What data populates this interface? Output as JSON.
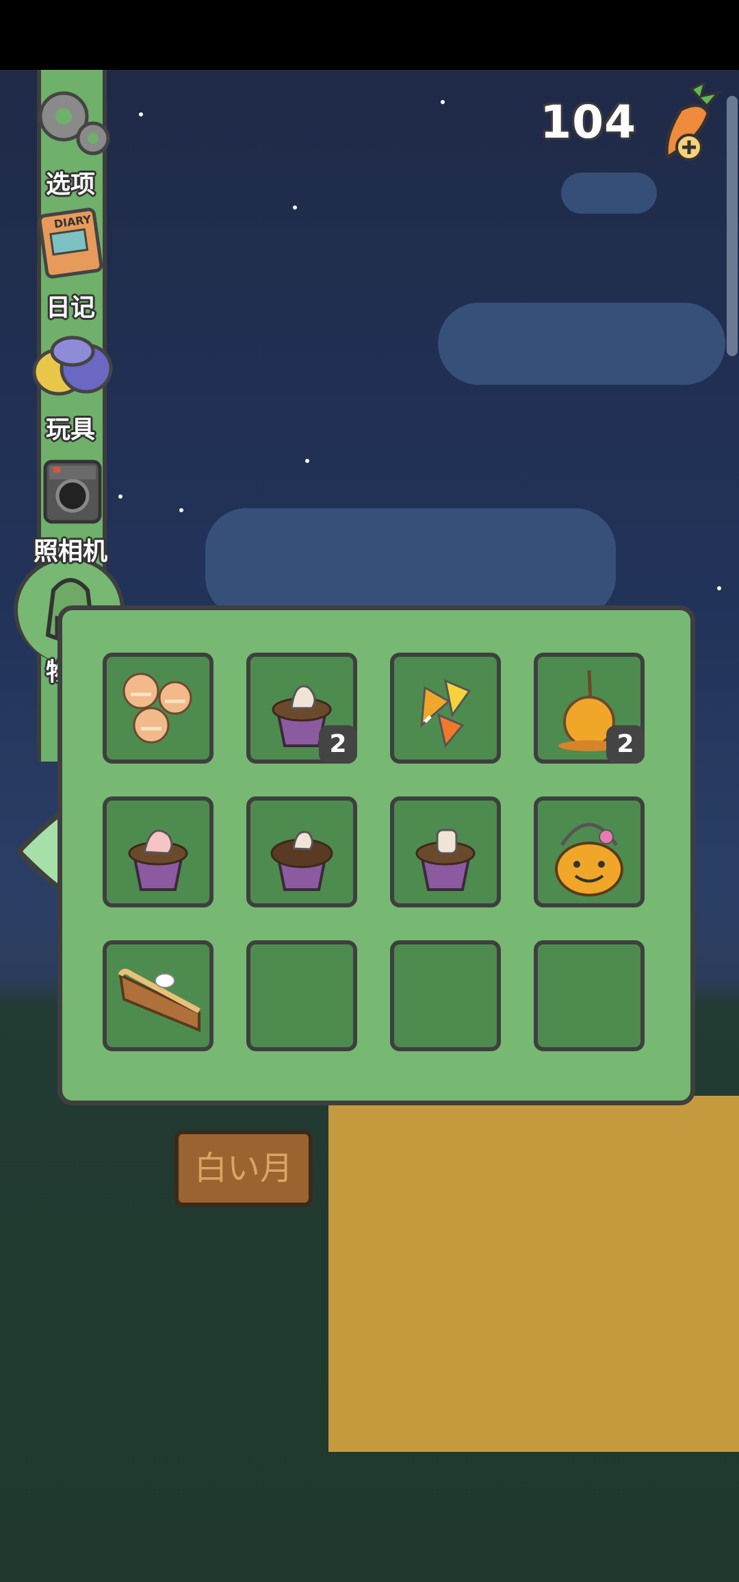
{
  "hud": {
    "carrot_count": "104",
    "carrot_icon": "carrot-plus-icon"
  },
  "side_menu": [
    {
      "label": "选项",
      "icon": "gears-icon"
    },
    {
      "label": "日记",
      "icon": "diary-icon"
    },
    {
      "label": "玩具",
      "icon": "toys-icon"
    },
    {
      "label": "照相机",
      "icon": "camera-icon"
    },
    {
      "label": "物品",
      "icon": "backpack-icon"
    }
  ],
  "inventory": {
    "slots": [
      {
        "item": "bunny-cookies-icon",
        "count": ""
      },
      {
        "item": "cupcake-icon",
        "count": "2"
      },
      {
        "item": "candy-corn-icon",
        "count": ""
      },
      {
        "item": "caramel-apple-icon",
        "count": "2"
      },
      {
        "item": "cupcake-icon",
        "count": ""
      },
      {
        "item": "chocolate-cupcake-icon",
        "count": ""
      },
      {
        "item": "cupcake-icon",
        "count": ""
      },
      {
        "item": "pumpkin-candy-basket-icon",
        "count": ""
      },
      {
        "item": "pie-slice-icon",
        "count": ""
      },
      {
        "item": "",
        "count": ""
      },
      {
        "item": "",
        "count": ""
      },
      {
        "item": "",
        "count": ""
      }
    ]
  },
  "scene": {
    "sign_text": "白い月"
  },
  "colors": {
    "panel": "#77b873",
    "slot": "#4e8b4f",
    "outline": "#3f3f3f",
    "sky": "#22335a"
  }
}
